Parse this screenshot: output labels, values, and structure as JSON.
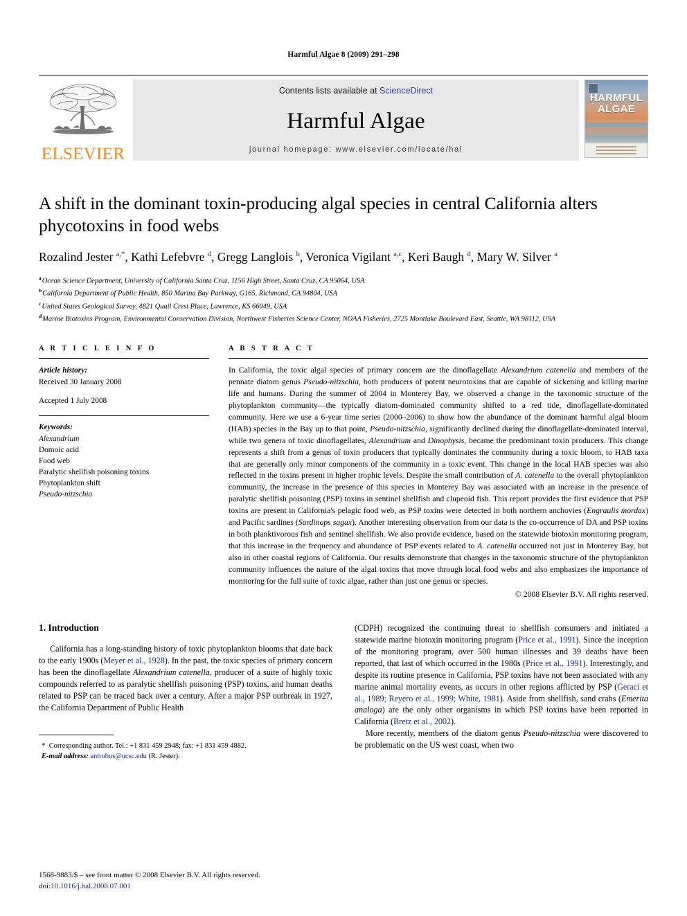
{
  "running_head": "Harmful Algae 8 (2009) 291–298",
  "masthead": {
    "publisher_name": "ELSEVIER",
    "contents_prefix": "Contents lists available at ",
    "contents_link": "ScienceDirect",
    "journal_title": "Harmful Algae",
    "homepage_line": "journal homepage: www.elsevier.com/locate/hal",
    "cover": {
      "line1": "HARMFUL",
      "line2": "ALGAE"
    },
    "link_color": "#3b3f9c",
    "elsevier_color": "#F18A21"
  },
  "article": {
    "title": "A shift in the dominant toxin-producing algal species in central California alters phycotoxins in food webs",
    "authors_html": "Rozalind Jester <sup>a,*</sup>, Kathi Lefebvre <sup>d</sup>, Gregg Langlois <sup>b</sup>, Veronica Vigilant <sup>a,c</sup>, Keri Baugh <sup>d</sup>, Mary W. Silver <sup>a</sup>",
    "affiliations": [
      {
        "marker": "a",
        "text": "Ocean Science Department, University of California Santa Cruz, 1156 High Street, Santa Cruz, CA 95064, USA"
      },
      {
        "marker": "b",
        "text": "California Department of Public Health, 850 Marina Bay Parkway, G165, Richmond, CA 94804, USA"
      },
      {
        "marker": "c",
        "text": "United States Geological Survey, 4821 Quail Crest Place, Lawrence, KS 66049, USA"
      },
      {
        "marker": "d",
        "text": "Marine Biotoxins Program, Environmental Conservation Division, Northwest Fisheries Science Center, NOAA Fisheries, 2725 Montlake Boulevard East, Seattle, WA 98112, USA"
      }
    ]
  },
  "article_info": {
    "heading": "A R T I C L E   I N F O",
    "history_label": "Article history:",
    "received": "Received 30 January 2008",
    "accepted": "Accepted 1 July 2008",
    "keywords_label": "Keywords:",
    "keywords": [
      {
        "text": "Alexandrium",
        "italic": true
      },
      {
        "text": "Domoic acid",
        "italic": false
      },
      {
        "text": "Food web",
        "italic": false
      },
      {
        "text": "Paralytic shellfish poisoning toxins",
        "italic": false
      },
      {
        "text": "Phytoplankton shift",
        "italic": false
      },
      {
        "text": "Pseudo-nitzschia",
        "italic": true
      }
    ]
  },
  "abstract": {
    "heading": "A B S T R A C T",
    "body_html": "In California, the toxic algal species of primary concern are the dinoflagellate <i>Alexandrium catenella</i> and members of the pennate diatom genus <i>Pseudo-nitzschia</i>, both producers of potent neurotoxins that are capable of sickening and killing marine life and humans. During the summer of 2004 in Monterey Bay, we observed a change in the taxonomic structure of the phytoplankton community—the typically diatom-dominated community shifted to a red tide, dinoflagellate-dominated community. Here we use a 6-year time series (2000–2006) to show how the abundance of the dominant harmful algal bloom (HAB) species in the Bay up to that point, <i>Pseudo-nitzschia</i>, significantly declined during the dinoflagellate-dominated interval, while two genera of toxic dinoflagellates, <i>Alexandrium</i> and <i>Dinophysis</i>, became the predominant toxin producers. This change represents a shift from a genus of toxin producers that typically dominates the community during a toxic bloom, to HAB taxa that are generally only minor components of the community in a toxic event. This change in the local HAB species was also reflected in the toxins present in higher trophic levels. Despite the small contribution of <i>A. catenella</i> to the overall phytoplankton community, the increase in the presence of this species in Monterey Bay was associated with an increase in the presence of paralytic shellfish poisoning (PSP) toxins in sentinel shellfish and clupeoid fish. This report provides the first evidence that PSP toxins are present in California's pelagic food web, as PSP toxins were detected in both northern anchovies (<i>Engraulis mordax</i>) and Pacific sardines (<i>Sardinops sagax</i>). Another interesting observation from our data is the co-occurrence of DA and PSP toxins in both planktivorous fish and sentinel shellfish. We also provide evidence, based on the statewide biotoxin monitoring program, that this increase in the frequency and abundance of PSP events related to <i>A. catenella</i> occurred not just in Monterey Bay, but also in other coastal regions of California. Our results demonstrate that changes in the taxonomic structure of the phytoplankton community influences the nature of the algal toxins that move through local food webs and also emphasizes the importance of monitoring for the full suite of toxic algae, rather than just one genus or species.",
    "copyright": "© 2008 Elsevier B.V. All rights reserved."
  },
  "introduction": {
    "heading": "1.  Introduction",
    "left_para_html": "California has a long-standing history of toxic phytoplankton blooms that date back to the early 1900s (<span class=\"cite\">Meyer et al., 1928</span>). In the past, the toxic species of primary concern has been the dinoflagellate <i>Alexandrium catenella</i>, producer of a suite of highly toxic compounds referred to as paralytic shellfish poisoning (PSP) toxins, and human deaths related to PSP can be traced back over a century. After a major PSP outbreak in 1927, the California Department of Public Health",
    "right_para1_html": "(CDPH) recognized the continuing threat to shellfish consumers and initiated a statewide marine biotoxin monitoring program (<span class=\"cite\">Price et al., 1991</span>). Since the inception of the monitoring program, over 500 human illnesses and 39 deaths have been reported, that last of which occurred in the 1980s (<span class=\"cite\">Price et al., 1991</span>). Interestingly, and despite its routine presence in California, PSP toxins have not been associated with any marine animal mortality events, as occurs in other regions afflicted by PSP (<span class=\"cite\">Geraci et al., 1989; Reyero et al., 1999; White, 1981</span>). Aside from shellfish, sand crabs (<i>Emerita analoga</i>) are the only other organisms in which PSP toxins have been reported in California (<span class=\"cite\">Bretz et al., 2002</span>).",
    "right_para2_html": "More recently, members of the diatom genus <i>Pseudo-nitzschia</i> were discovered to be problematic on the US west coast, when two"
  },
  "footnote": {
    "corresponding_html": "<span class=\"star\">*</span>&nbsp; Corresponding author. Tel.: +1 831 459 2948; fax: +1 831 459 4882.",
    "email_html": "<span class=\"em\">E-mail address:</span> <span class=\"link\">antrobus@ucsc.edu</span> (R. Jester)."
  },
  "page_footer": {
    "front_matter": "1568-9883/$ – see front matter © 2008 Elsevier B.V. All rights reserved.",
    "doi_label": "doi:",
    "doi_value": "10.1016/j.hal.2008.07.001"
  }
}
